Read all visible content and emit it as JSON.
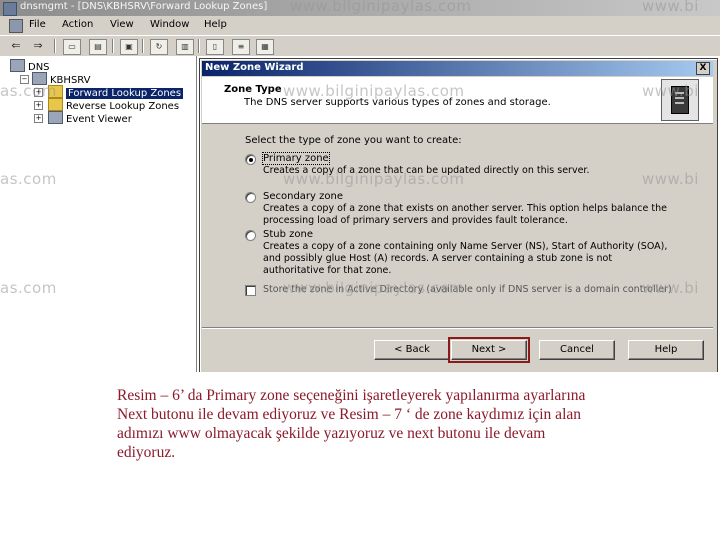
{
  "window": {
    "title": "dnsmgmt - [DNS\\KBHSRV\\Forward Lookup Zones]"
  },
  "menu": [
    "File",
    "Action",
    "View",
    "Window",
    "Help"
  ],
  "toolbar_icons": [
    "back-icon",
    "forward-icon",
    "up-folder-icon",
    "show-hide-tree-icon",
    "properties-icon",
    "refresh-icon",
    "export-list-icon",
    "help-icon",
    "list-icon",
    "details-icon",
    "new-folder-icon"
  ],
  "tree": {
    "root": "DNS",
    "server": "KBHSRV",
    "items": [
      {
        "label": "Forward Lookup Zones",
        "selected": true,
        "expander": "+"
      },
      {
        "label": "Reverse Lookup Zones",
        "selected": false,
        "expander": "+"
      },
      {
        "label": "Event Viewer",
        "selected": false,
        "expander": "+"
      }
    ]
  },
  "dialog": {
    "title": "New Zone Wizard",
    "close": "X",
    "header_title": "Zone Type",
    "header_subtitle": "The DNS server supports various types of zones and storage.",
    "prompt": "Select the type of zone you want to create:",
    "options": [
      {
        "label": "Primary zone",
        "selected": true,
        "desc": "Creates a copy of a zone that can be updated directly on this server."
      },
      {
        "label": "Secondary zone",
        "selected": false,
        "desc": "Creates a copy of a zone that exists on another server. This option helps balance the processing load of primary servers and provides fault tolerance."
      },
      {
        "label": "Stub zone",
        "selected": false,
        "desc": "Creates a copy of a zone containing only Name Server (NS), Start of Authority (SOA), and possibly glue Host (A) records. A server containing a stub zone is not authoritative for that zone."
      }
    ],
    "checkbox_label": "Store the zone in Active Directory (available only if DNS server is a domain controller)",
    "checkbox_checked": false,
    "buttons": {
      "back": "< Back",
      "next": "Next >",
      "cancel": "Cancel",
      "help": "Help"
    }
  },
  "watermark": {
    "site": "www.bilginipaylas.com",
    "fragment_a": "as.com",
    "fragment_b": "www.bi"
  },
  "caption": "Resim – 6’ da Primary zone seçeneğini işaretleyerek yapılanırma ayarlarına Next butonu ile devam ediyoruz ve Resim – 7 ‘ de zone kaydımız için alan adımızı www olmayacak şekilde yazıyoruz ve next butonu ile devam ediyoruz."
}
